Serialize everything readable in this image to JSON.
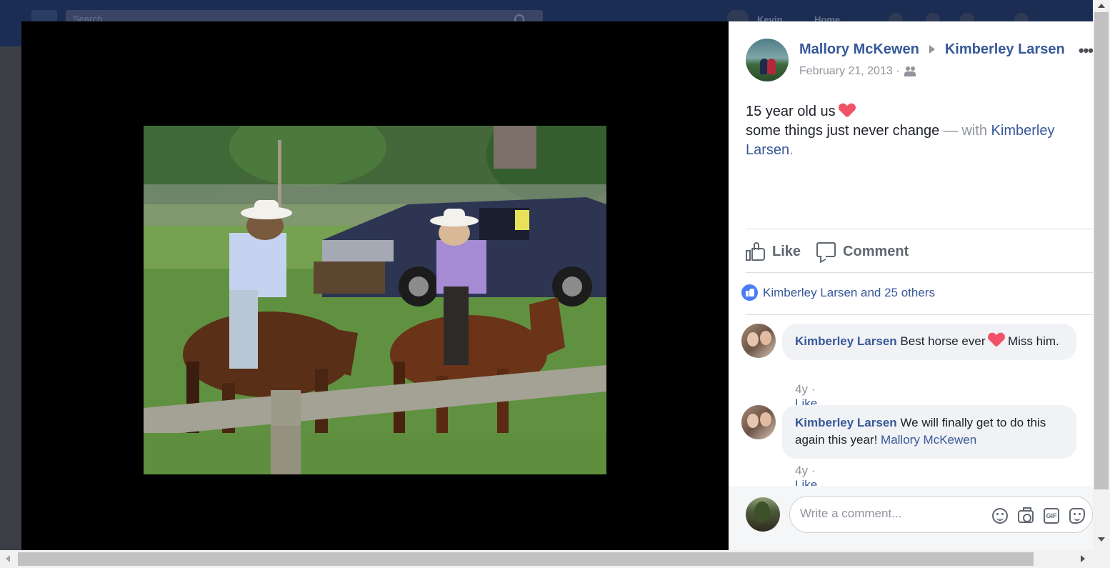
{
  "background": {
    "search_placeholder": "Search",
    "user_name": "Kevin",
    "home_label": "Home"
  },
  "post": {
    "author": "Mallory McKewen",
    "target": "Kimberley Larsen",
    "more_label": "•••",
    "date": "February 21, 2013",
    "date_separator": "·",
    "audience_icon": "friends-icon",
    "text_line1": "15 year old us",
    "text_line2": "some things just never change",
    "with_label": "— with",
    "tagged": "Kimberley Larsen",
    "period": "."
  },
  "actions": {
    "like_label": "Like",
    "comment_label": "Comment"
  },
  "reactions": {
    "summary": "Kimberley Larsen and 25 others"
  },
  "comments": [
    {
      "author": "Kimberley Larsen",
      "text_before": "Best horse ever",
      "text_after": "Miss him.",
      "age": "4y",
      "separator": "·",
      "like_label": "Like"
    },
    {
      "author": "Kimberley Larsen",
      "text": "We will finally get to do this again this year!",
      "mention": "Mallory McKewen",
      "age": "4y",
      "separator": "·",
      "like_label": "Like"
    }
  ],
  "composer": {
    "placeholder": "Write a comment...",
    "gif_label": "GIF"
  },
  "colors": {
    "link_blue": "#365899",
    "like_blue": "#4a7cf6",
    "heart_red": "#f25268",
    "muted_grey": "#90949c"
  }
}
